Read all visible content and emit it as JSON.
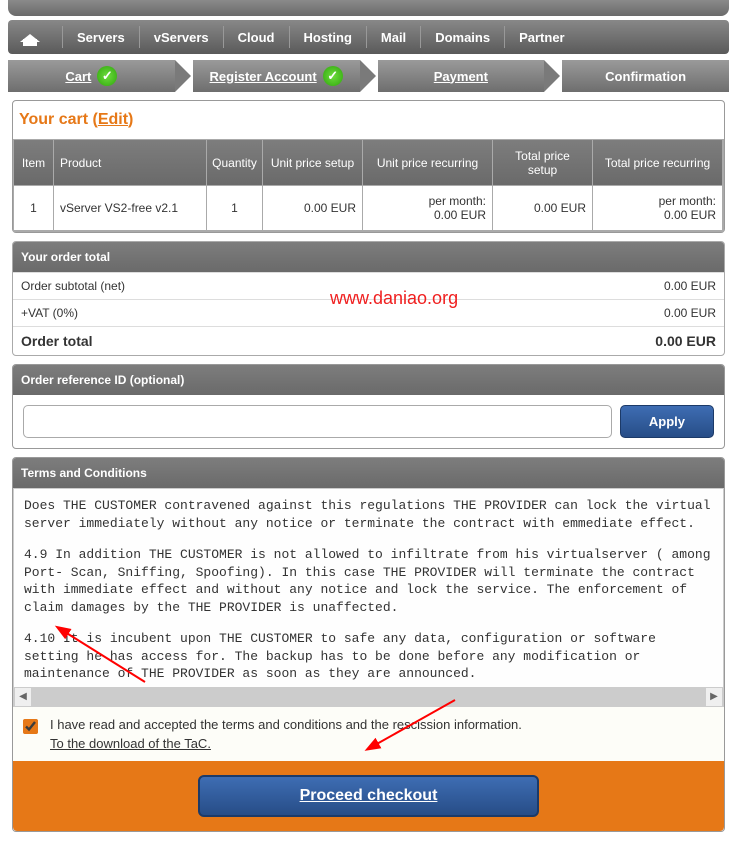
{
  "nav": {
    "items": [
      "Servers",
      "vServers",
      "Cloud",
      "Hosting",
      "Mail",
      "Domains",
      "Partner"
    ]
  },
  "steps": {
    "s1": "Cart",
    "s2": "Register Account",
    "s3": "Payment",
    "s4": "Confirmation"
  },
  "cart": {
    "title_prefix": "Your cart (",
    "edit": "Edit",
    "title_suffix": ")",
    "headers": {
      "item": "Item",
      "product": "Product",
      "qty": "Quantity",
      "unit_setup": "Unit price setup",
      "unit_recurring": "Unit price recurring",
      "total_setup": "Total price setup",
      "total_recurring": "Total price recurring"
    },
    "row": {
      "item": "1",
      "product": "vServer VS2-free v2.1",
      "qty": "1",
      "unit_setup": "0.00 EUR",
      "unit_recurring_l1": "per month:",
      "unit_recurring_l2": "0.00 EUR",
      "total_setup": "0.00 EUR",
      "total_recurring_l1": "per month:",
      "total_recurring_l2": "0.00 EUR"
    }
  },
  "totals": {
    "header": "Your order total",
    "subtotal_label": "Order subtotal (net)",
    "subtotal_value": "0.00 EUR",
    "vat_label": "+VAT (0%)",
    "vat_value": "0.00 EUR",
    "total_label": "Order total",
    "total_value": "0.00 EUR"
  },
  "ref": {
    "header": "Order reference ID (optional)",
    "apply": "Apply"
  },
  "tc": {
    "header": "Terms and Conditions",
    "p1": "Does THE CUSTOMER contravened against this regulations THE PROVIDER can lock the virtual server immediately without any notice or terminate the contract with emmediate effect.",
    "p2": "4.9 In addition THE CUSTOMER is not allowed to infiltrate from his virtualserver ( among Port- Scan, Sniffing, Spoofing). In this case THE PROVIDER will terminate the contract with immediate effect and without any notice and lock the service. The enforcement of claim damages by the THE PROVIDER is unaffected.",
    "p3": "4.10 It is incubent upon THE CUSTOMER to safe any data, configuration or software setting he has access for. The backup has to be done before any modification or maintenance of THE PROVIDER as soon as they are announced.",
    "accept": "I have read and accepted the terms and conditions and the rescission information.",
    "download": "To the download of the TaC."
  },
  "proceed": "Proceed checkout",
  "watermark": "www.daniao.org"
}
